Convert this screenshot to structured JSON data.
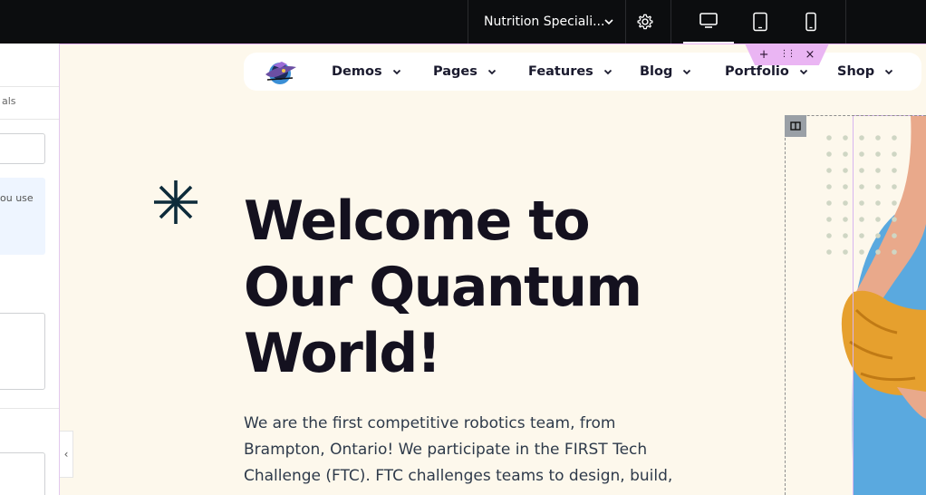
{
  "editor": {
    "page_title": "Nutrition Speciali...",
    "settings_icon": "gear-icon",
    "devices": [
      {
        "name": "desktop",
        "active": true
      },
      {
        "name": "tablet",
        "active": false
      },
      {
        "name": "mobile",
        "active": false
      }
    ]
  },
  "left_panel": {
    "tab_fragment": "als",
    "note_fragment": "ou use",
    "collapse_icon": "‹"
  },
  "section_toolbar": {
    "add": "+",
    "move": "⋮⋮",
    "close": "×"
  },
  "nav": {
    "items": [
      {
        "label": "Demos"
      },
      {
        "label": "Pages"
      },
      {
        "label": "Features"
      },
      {
        "label": "Blog"
      },
      {
        "label": "Portfolio"
      },
      {
        "label": "Shop"
      }
    ]
  },
  "hero": {
    "headline_lines": [
      "Welcome to",
      "Our Quantum",
      "World!"
    ],
    "paragraph_lines": [
      "We are the first competitive robotics team, from",
      "Brampton, Ontario! We participate in the FIRST Tech",
      "Challenge (FTC). FTC challenges teams to design, build,"
    ]
  },
  "colors": {
    "topbar": "#0c0d0f",
    "page_bg": "#fdf8ec",
    "heading": "#14111f",
    "accent_dark": "#0d2b3a",
    "toolbar_pink": "#eab5f3",
    "image_blue": "#5aa9df",
    "sleeve_orange": "#e6a02e"
  }
}
